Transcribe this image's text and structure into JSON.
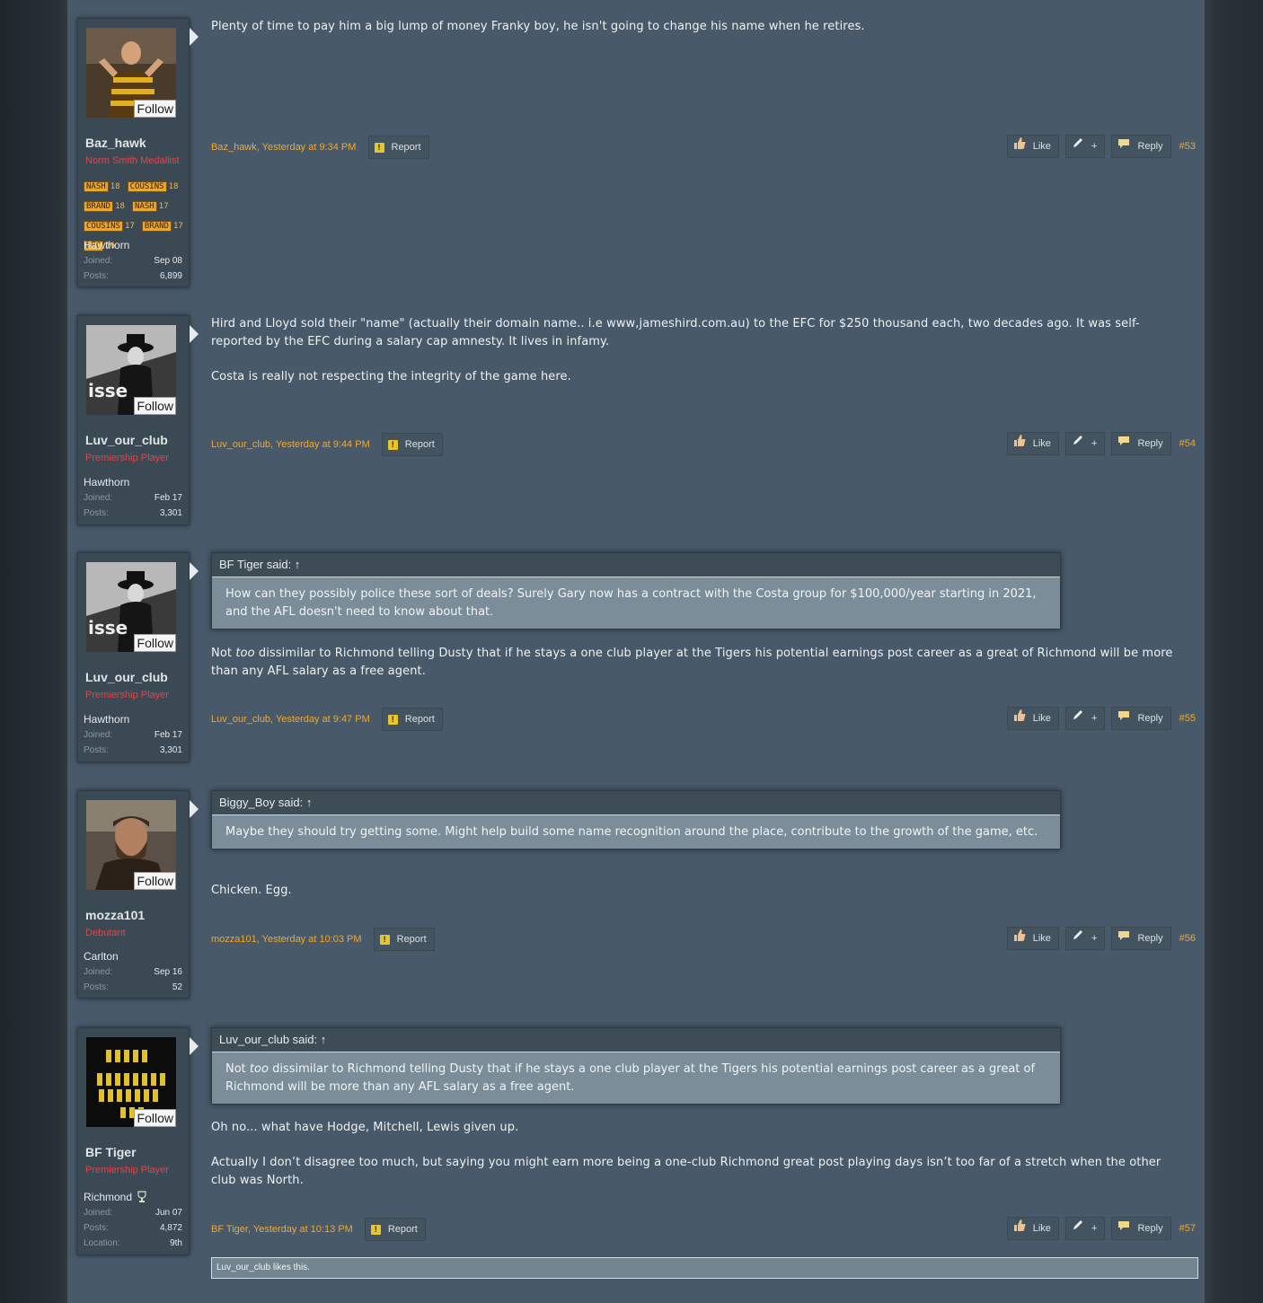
{
  "follow_label": "Follow",
  "labels": {
    "joined": "Joined:",
    "posts": "Posts:",
    "location": "Location:"
  },
  "buttons": {
    "report": "Report",
    "like": "Like",
    "plus": "+",
    "reply": "Reply"
  },
  "colors": {
    "link": "#f0a830",
    "title_red": "#e0464a",
    "badge": "#e8a632"
  },
  "posts": [
    {
      "user": {
        "name": "Baz_hawk",
        "title": "Norm Smith Medallist",
        "team": "Hawthorn",
        "joined": "Sep 08",
        "posts": "6,899",
        "badges": [
          {
            "label": "NASH",
            "num": "18"
          },
          {
            "label": "COUSINS",
            "num": "18"
          },
          {
            "label": "BRAND",
            "num": "18"
          },
          {
            "label": "NASH",
            "num": "17"
          },
          {
            "label": "COUSINS",
            "num": "17"
          },
          {
            "label": "BRAND",
            "num": "17"
          },
          {
            "label": "HFC",
            "num": "16"
          }
        ],
        "avatar": "hawthorn-player-avatar"
      },
      "body": [
        "Plenty of time to pay him a big lump of money Franky boy, he isn't going to change his name when he retires."
      ],
      "meta": "Baz_hawk, Yesterday at 9:34 PM",
      "number": "#53"
    },
    {
      "user": {
        "name": "Luv_our_club",
        "title": "Premiership Player",
        "team": "Hawthorn",
        "joined": "Feb 17",
        "posts": "3,301",
        "avatar": "bw-film-man-avatar"
      },
      "body": [
        "Hird and Lloyd sold their \"name\" (actually their domain name.. i.e www,jameshird.com.au) to the EFC for $250 thousand each, two decades ago. It was self-reported by the EFC during a salary cap amnesty. It lives in infamy.",
        "Costa is really not respecting the integrity of the game here."
      ],
      "meta": "Luv_our_club, Yesterday at 9:44 PM",
      "number": "#54"
    },
    {
      "user": {
        "name": "Luv_our_club",
        "title": "Premiership Player",
        "team": "Hawthorn",
        "joined": "Feb 17",
        "posts": "3,301",
        "avatar": "bw-film-man-avatar"
      },
      "quote": {
        "author": "BF Tiger said: ↑",
        "text": "How can they possibly police these sort of deals? Surely Gary now has a contract with the Costa group for $100,000/year starting in 2021, and the AFL doesn't need to know about that."
      },
      "body_pre": "Not ",
      "body_em": "too",
      "body_post": " dissimilar to Richmond telling Dusty that if he stays a one club player at the Tigers his potential earnings post career as a great of Richmond will be more than any AFL salary as a free agent.",
      "meta": "Luv_our_club, Yesterday at 9:47 PM",
      "number": "#55"
    },
    {
      "user": {
        "name": "mozza101",
        "title": "Debutant",
        "team": "Carlton",
        "joined": "Sep 16",
        "posts": "52",
        "avatar": "bearded-man-avatar"
      },
      "quote": {
        "author": "Biggy_Boy said: ↑",
        "text": "Maybe they should try getting some. Might help build some name recognition around the place, contribute to the growth of the game, etc."
      },
      "body": [
        "Chicken. Egg."
      ],
      "meta": "mozza101, Yesterday at 10:03 PM",
      "number": "#56"
    },
    {
      "user": {
        "name": "BF Tiger",
        "title": "Premiership Player",
        "team": "Richmond",
        "joined": "Jun 07",
        "posts": "4,872",
        "location": "9th",
        "avatar": "team-photo-avatar",
        "team_icon": "trophy-icon"
      },
      "quote": {
        "author": "Luv_our_club said: ↑",
        "text_pre": "Not ",
        "text_em": "too",
        "text_post": " dissimilar to Richmond telling Dusty that if he stays a one club player at the Tigers his potential earnings post career as a great of Richmond will be more than any AFL salary as a free agent."
      },
      "body": [
        "Oh no... what have Hodge, Mitchell, Lewis given up.",
        "Actually I don’t disagree too much, but saying you might earn more being a one-club Richmond great post playing days isn’t too far of a stretch when the other club was North."
      ],
      "meta": "BF Tiger, Yesterday at 10:13 PM",
      "number": "#57",
      "likes": "Luv_our_club likes this."
    }
  ]
}
